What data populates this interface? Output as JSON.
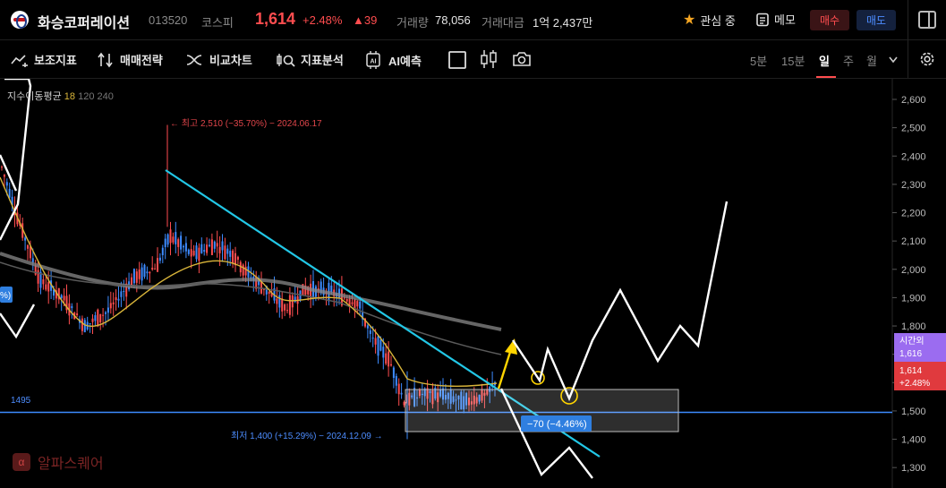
{
  "header": {
    "name": "화승코퍼레이션",
    "code": "013520",
    "market": "코스피",
    "price": "1,614",
    "change_pct": "+2.48%",
    "change_abs": "▲39",
    "volume_label": "거래량",
    "volume": "78,056",
    "amount_label": "거래대금",
    "amount": "1억 2,437만",
    "watch_label": "관심 중",
    "memo_label": "메모",
    "buy_label": "매수",
    "sell_label": "매도"
  },
  "toolbar": {
    "tools": [
      "보조지표",
      "매매전략",
      "비교차트",
      "지표분석",
      "AI예측"
    ],
    "periods": [
      "5분",
      "15분",
      "일",
      "주",
      "월"
    ],
    "active_period": "일"
  },
  "chart": {
    "ma_legend": {
      "label": "지수이동평균",
      "p1": "18",
      "p2": "120",
      "p3": "240"
    },
    "high_annotation": "최고 2,510 (−35.70%) − 2024.06.17",
    "low_annotation": "최저 1,400 (+15.29%) − 2024.12.09",
    "hline_label": "1495",
    "hline_value": 1495,
    "measure_label": "−70 (−4.46%)",
    "left_tag": "%)",
    "after_hours_label": "시간외",
    "after_hours_price": "1,616",
    "current_price": "1,614",
    "current_pct": "+2.48%",
    "yaxis_ticks": [
      "2,600",
      "2,500",
      "2,400",
      "2,300",
      "2,200",
      "2,100",
      "2,000",
      "1,900",
      "1,800",
      "1,700",
      "1,600",
      "1,500",
      "1,400",
      "1,300"
    ],
    "yaxis_values": [
      2600,
      2500,
      2400,
      2300,
      2200,
      2100,
      2000,
      1900,
      1800,
      1700,
      1600,
      1500,
      1400,
      1300
    ],
    "watermark": "알파스퀘어",
    "colors": {
      "up": "#ff4d4f",
      "down": "#3d8bff",
      "trendline": "#22c7e6",
      "hline": "#3d8bff",
      "ma18": "#d9b53a",
      "ma120": "#888888",
      "ma240": "#5a5a5a",
      "arrow": "#ffd400",
      "projection": "#ffffff"
    }
  }
}
